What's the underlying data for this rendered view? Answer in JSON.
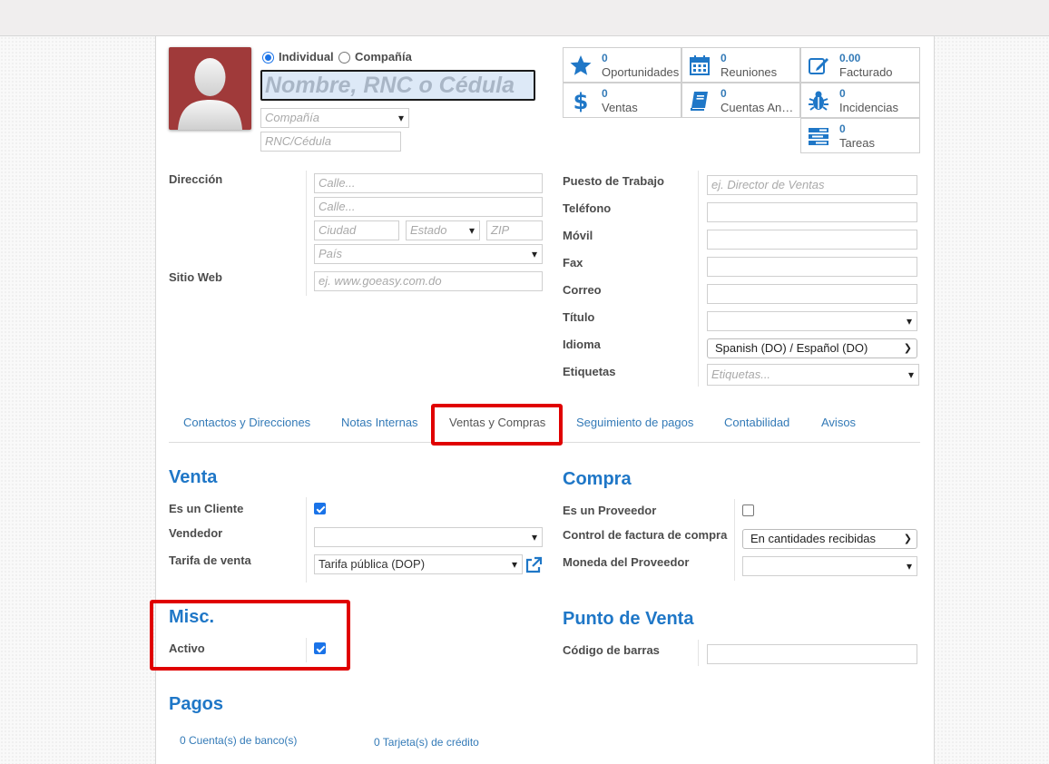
{
  "header": {
    "type_individual": "Individual",
    "type_company": "Compañía",
    "name_placeholder": "Nombre, RNC o Cédula",
    "company_placeholder": "Compañía",
    "rnc_placeholder": "RNC/Cédula"
  },
  "stats": [
    {
      "value": "0",
      "label": "Oportunidades",
      "icon": "star-icon"
    },
    {
      "value": "0",
      "label": "Reuniones",
      "icon": "calendar-icon"
    },
    {
      "value": "0.00",
      "label": "Facturado",
      "icon": "edit-icon"
    },
    {
      "value": "0",
      "label": "Ventas",
      "icon": "dollar-icon"
    },
    {
      "value": "0",
      "label": "Cuentas Analíticas",
      "icon": "book-icon"
    },
    {
      "value": "0",
      "label": "Incidencias",
      "icon": "bug-icon"
    },
    {
      "value": "0",
      "label": "Tareas",
      "icon": "tasks-icon"
    }
  ],
  "address": {
    "label": "Dirección",
    "street_placeholder": "Calle...",
    "street2_placeholder": "Calle...",
    "city_placeholder": "Ciudad",
    "state_placeholder": "Estado",
    "zip_placeholder": "ZIP",
    "country_placeholder": "País",
    "website_label": "Sitio Web",
    "website_placeholder": "ej. www.goeasy.com.do"
  },
  "contact": {
    "job_label": "Puesto de Trabajo",
    "job_placeholder": "ej. Director de Ventas",
    "phone_label": "Teléfono",
    "mobile_label": "Móvil",
    "fax_label": "Fax",
    "email_label": "Correo",
    "title_label": "Título",
    "language_label": "Idioma",
    "language_value": "Spanish (DO) / Español (DO)",
    "tags_label": "Etiquetas",
    "tags_placeholder": "Etiquetas..."
  },
  "tabs": [
    {
      "label": "Contactos y Direcciones"
    },
    {
      "label": "Notas Internas"
    },
    {
      "label": "Ventas y Compras"
    },
    {
      "label": "Seguimiento de pagos"
    },
    {
      "label": "Contabilidad"
    },
    {
      "label": "Avisos"
    }
  ],
  "venta": {
    "title": "Venta",
    "customer_label": "Es un Cliente",
    "salesperson_label": "Vendedor",
    "pricelist_label": "Tarifa de venta",
    "pricelist_value": "Tarifa pública (DOP)"
  },
  "compra": {
    "title": "Compra",
    "supplier_label": "Es un Proveedor",
    "invoice_control_label": "Control de factura de compra",
    "invoice_control_value": "En cantidades recibidas",
    "currency_label": "Moneda del Proveedor"
  },
  "misc": {
    "title": "Misc.",
    "active_label": "Activo"
  },
  "pos": {
    "title": "Punto de Venta",
    "barcode_label": "Código de barras"
  },
  "pagos": {
    "title": "Pagos",
    "bank_link": "0 Cuenta(s) de banco(s)",
    "card_link": "0 Tarjeta(s) de crédito"
  },
  "colors": {
    "accent": "#1f77c7",
    "link": "#337ab7",
    "highlight": "#e00000",
    "avatar_bg": "#a03a3a"
  }
}
